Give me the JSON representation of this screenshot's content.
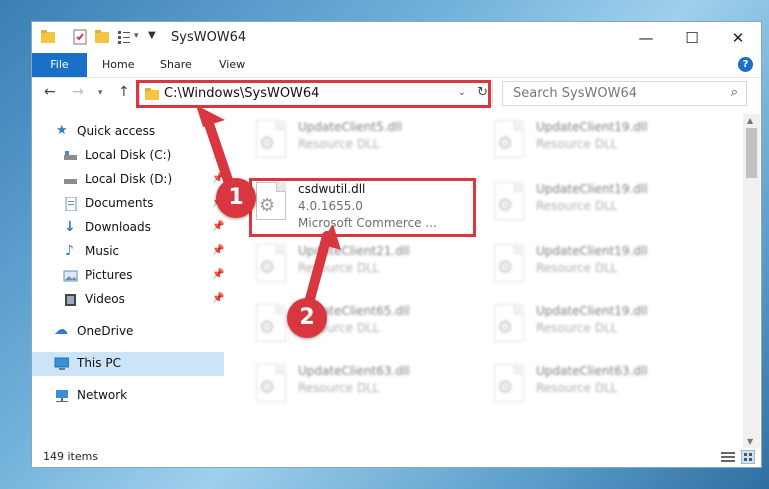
{
  "window": {
    "title": "SysWOW64",
    "controls": {
      "minimize": "—",
      "maximize": "☐",
      "close": "✕"
    }
  },
  "ribbon": {
    "tabs": [
      "File",
      "Home",
      "Share",
      "View"
    ],
    "help": "?"
  },
  "address": {
    "path": "C:\\Windows\\SysWOW64",
    "search_placeholder": "Search SysWOW64"
  },
  "nav": {
    "items": [
      {
        "label": "Quick access",
        "icon": "star-icon",
        "pinned": false
      },
      {
        "label": "Local Disk (C:)",
        "icon": "drive-icon",
        "pinned": true
      },
      {
        "label": "Local Disk (D:)",
        "icon": "drive-icon",
        "pinned": true
      },
      {
        "label": "Documents",
        "icon": "documents-icon",
        "pinned": true
      },
      {
        "label": "Downloads",
        "icon": "download-icon",
        "pinned": true
      },
      {
        "label": "Music",
        "icon": "music-icon",
        "pinned": true
      },
      {
        "label": "Pictures",
        "icon": "pictures-icon",
        "pinned": true
      },
      {
        "label": "Videos",
        "icon": "videos-icon",
        "pinned": true
      },
      {
        "label": "OneDrive",
        "icon": "cloud-icon",
        "pinned": false
      },
      {
        "label": "This PC",
        "icon": "computer-icon",
        "pinned": false,
        "selected": true
      },
      {
        "label": "Network",
        "icon": "network-icon",
        "pinned": false
      }
    ]
  },
  "files": {
    "left": [
      {
        "name": "UpdateClient5.dll",
        "desc": "Resource DLL",
        "blurred": true
      },
      {
        "name": "csdwutil.dll",
        "version": "4.0.1655.0",
        "company": "Microsoft Commerce ...",
        "blurred": false
      },
      {
        "name": "UpdateClient21.dll",
        "desc": "Resource DLL",
        "blurred": true
      },
      {
        "name": "UpdateClient65.dll",
        "desc": "Resource DLL",
        "blurred": true
      },
      {
        "name": "UpdateClient63.dll",
        "desc": "Resource DLL",
        "blurred": true
      }
    ],
    "right": [
      {
        "name": "UpdateClient19.dll",
        "desc": "Resource DLL"
      },
      {
        "name": "UpdateClient19.dll",
        "desc": "Resource DLL"
      },
      {
        "name": "UpdateClient19.dll",
        "desc": "Resource DLL"
      },
      {
        "name": "UpdateClient19.dll",
        "desc": "Resource DLL"
      },
      {
        "name": "UpdateClient63.dll",
        "desc": "Resource DLL"
      }
    ]
  },
  "status": {
    "count": "149 items"
  },
  "callouts": {
    "one": "1",
    "two": "2"
  },
  "colors": {
    "accent": "#1a6fc7",
    "highlight": "#d9373f",
    "selection": "#cce4f7"
  }
}
